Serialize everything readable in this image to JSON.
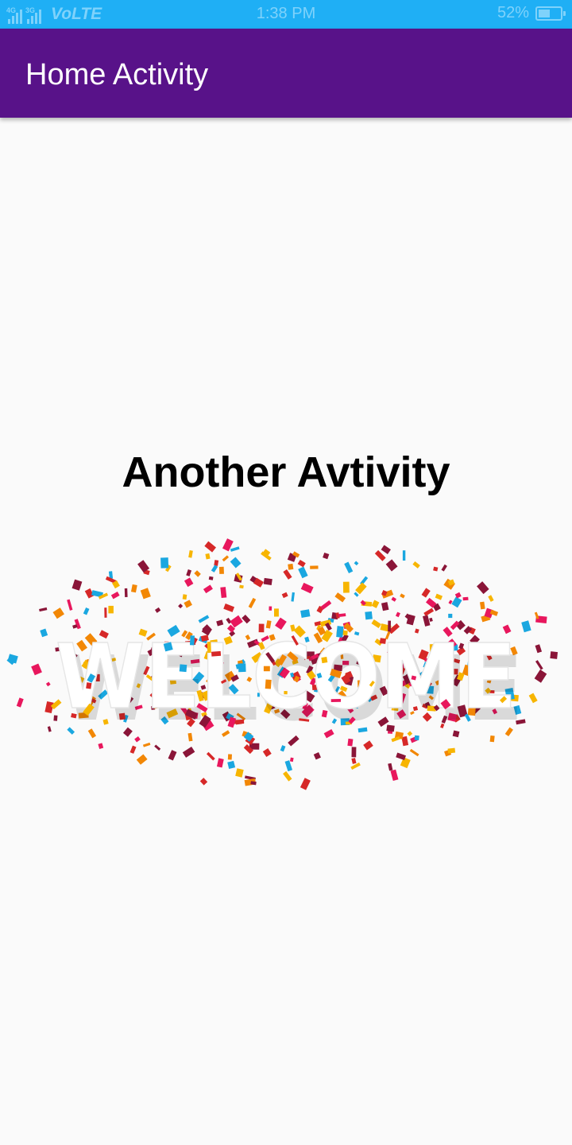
{
  "status_bar": {
    "network_4g": "4G",
    "network_3g": "3G",
    "volte": "VoLTE",
    "time": "1:38 PM",
    "battery_text": "52%",
    "battery_level": 0.52
  },
  "app_bar": {
    "title": "Home Activity",
    "color": "#581289"
  },
  "content": {
    "heading": "Another Avtivity",
    "image": {
      "word": "WELCOME",
      "confetti_colors": [
        "#e8175d",
        "#1aa7e0",
        "#f7b500",
        "#d62828",
        "#8a1538",
        "#f28705"
      ]
    }
  },
  "colors": {
    "status_bar": "#1faff5",
    "background": "#fafafa"
  }
}
